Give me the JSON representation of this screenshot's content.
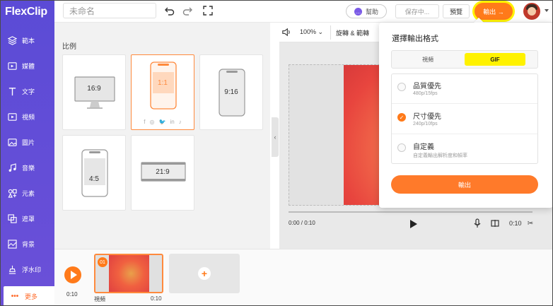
{
  "app": {
    "logo_text": "FlexClip"
  },
  "sidebar": {
    "items": [
      {
        "label": "範本",
        "icon": "layers-icon"
      },
      {
        "label": "媒體",
        "icon": "media-icon"
      },
      {
        "label": "文字",
        "icon": "text-icon"
      },
      {
        "label": "視頻",
        "icon": "video-icon"
      },
      {
        "label": "圖片",
        "icon": "image-icon"
      },
      {
        "label": "音樂",
        "icon": "music-icon"
      },
      {
        "label": "元素",
        "icon": "elements-icon"
      },
      {
        "label": "遮罩",
        "icon": "overlay-icon"
      },
      {
        "label": "背景",
        "icon": "background-icon"
      },
      {
        "label": "浮水印",
        "icon": "watermark-icon"
      },
      {
        "label": "更多",
        "icon": "more-icon"
      }
    ],
    "active_index": 10
  },
  "topbar": {
    "title_placeholder": "未命名",
    "help_label": "幫助",
    "save_label": "保存中...",
    "preview_label": "預覽",
    "export_label": "輸出 →"
  },
  "ratio_panel": {
    "title": "比例",
    "options": [
      {
        "label": "16:9",
        "selected": false
      },
      {
        "label": "1:1",
        "selected": true
      },
      {
        "label": "9:16",
        "selected": false
      },
      {
        "label": "4:5",
        "selected": false
      },
      {
        "label": "21:9",
        "selected": false
      }
    ],
    "social_icons": [
      "f",
      "◎",
      "🐦",
      "in",
      "♪"
    ]
  },
  "preview": {
    "zoom": "100%",
    "rotate_crop_label": "旋轉 & 範轉",
    "time_current": "0:00 / 0:10",
    "time_total": "0:10"
  },
  "timeline": {
    "total_time": "0:10",
    "clip": {
      "number": "01",
      "label": "視頻",
      "duration": "0:10"
    }
  },
  "export_popup": {
    "title": "選擇輸出格式",
    "tabs": [
      {
        "label": "視頻",
        "active": false
      },
      {
        "label": "GIF",
        "active": true
      }
    ],
    "options": [
      {
        "title": "品質優先",
        "subtitle": "480p/15fps",
        "checked": false
      },
      {
        "title": "尺寸優先",
        "subtitle": "240p/10fps",
        "checked": true
      },
      {
        "title": "自定義",
        "subtitle": "自定義輸出解析度和幀率",
        "checked": false
      }
    ],
    "export_button": "輸出"
  },
  "colors": {
    "sidebar": "#5b4bd6",
    "accent": "#ff7a1a",
    "highlight": "#fff200"
  }
}
